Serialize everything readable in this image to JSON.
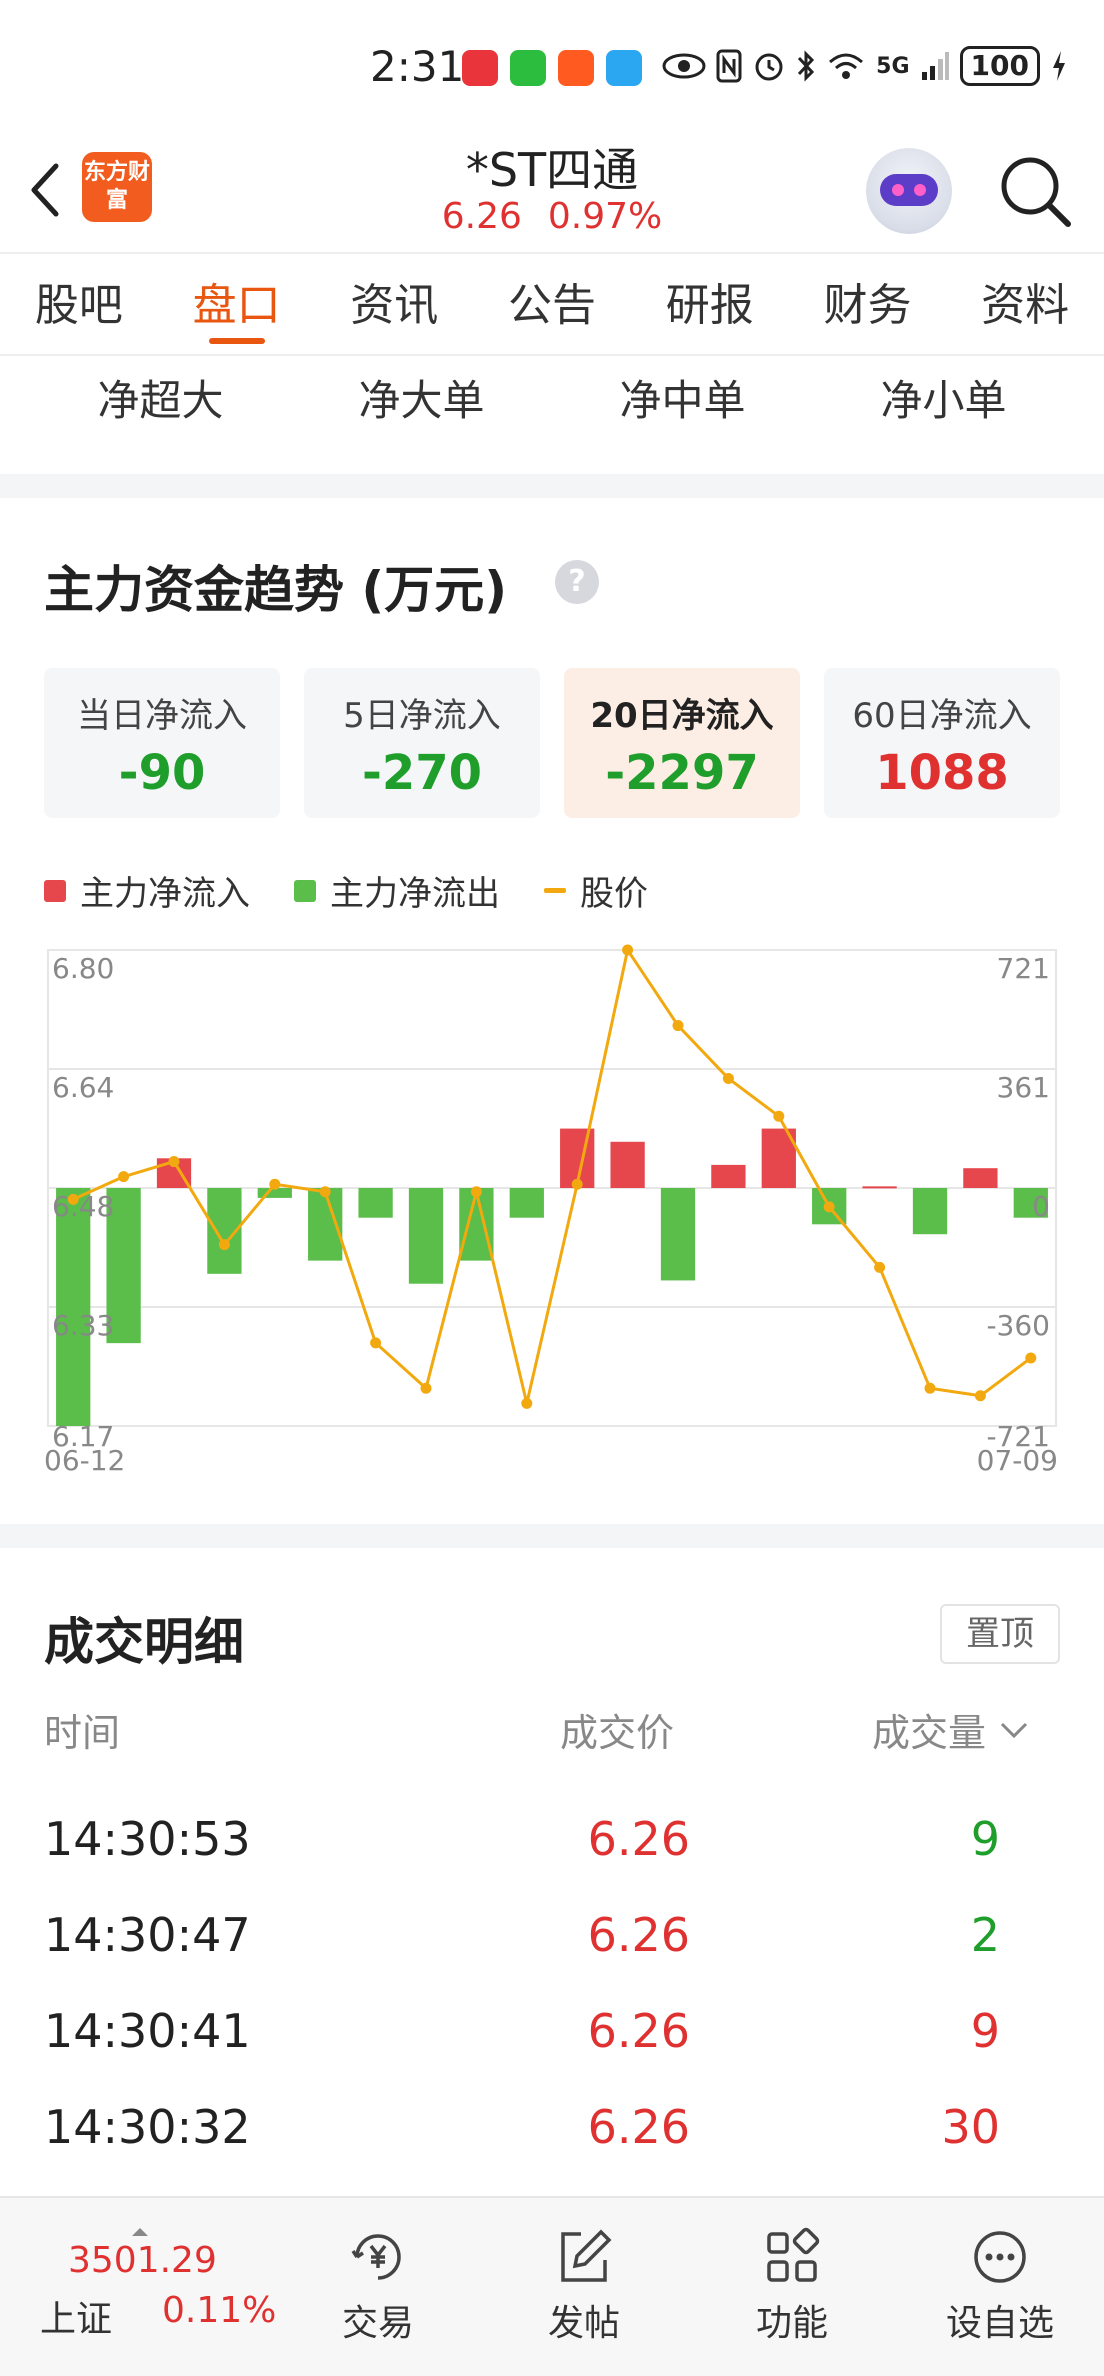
{
  "status_bar": {
    "time": "2:31",
    "network": "5G",
    "battery": "100"
  },
  "header": {
    "logo_text": "东方财富",
    "stock_name": "*ST四通",
    "price": "6.26",
    "change_pct": "0.97%"
  },
  "tabs": [
    {
      "label": "股吧"
    },
    {
      "label": "盘口"
    },
    {
      "label": "资讯"
    },
    {
      "label": "公告"
    },
    {
      "label": "研报"
    },
    {
      "label": "财务"
    },
    {
      "label": "资料"
    }
  ],
  "active_tab": "盘口",
  "subtabs": [
    {
      "label": "净超大"
    },
    {
      "label": "净大单"
    },
    {
      "label": "净中单"
    },
    {
      "label": "净小单"
    }
  ],
  "fund_section": {
    "title": "主力资金趋势 (万元)",
    "help_symbol": "?"
  },
  "flow_cards": [
    {
      "label": "当日净流入",
      "value": "-90",
      "color": "#1f9e2c",
      "active": false
    },
    {
      "label": "5日净流入",
      "value": "-270",
      "color": "#1f9e2c",
      "active": false
    },
    {
      "label": "20日净流入",
      "value": "-2297",
      "color": "#1f9e2c",
      "active": true
    },
    {
      "label": "60日净流入",
      "value": "1088",
      "color": "#e03131",
      "active": false
    }
  ],
  "legend": {
    "inflow": "主力净流入",
    "outflow": "主力净流出",
    "price": "股价"
  },
  "colors": {
    "accent": "#e8560f",
    "up": "#e03131",
    "down": "#1f9e2c",
    "bar_up": "#e5474d",
    "bar_down": "#5bbd4a",
    "price_line": "#f2a90f"
  },
  "chart_data": {
    "type": "bar",
    "title": "主力资金趋势 (万元)",
    "x_start_label": "06-12",
    "x_end_label": "07-09",
    "left_axis": {
      "ticks": [
        "6.80",
        "6.64",
        "6.48",
        "6.33",
        "6.17"
      ],
      "range": [
        6.17,
        6.8
      ]
    },
    "right_axis": {
      "ticks": [
        "721",
        "361",
        "0",
        "-360",
        "-721"
      ],
      "range": [
        -721,
        721
      ]
    },
    "grid": true,
    "series": [
      {
        "name": "主力净流入/主力净流出",
        "type": "bar",
        "values": [
          -721,
          -470,
          90,
          -260,
          -30,
          -220,
          -90,
          -290,
          -220,
          -90,
          180,
          140,
          -280,
          70,
          180,
          -110,
          5,
          -140,
          60,
          -90
        ]
      },
      {
        "name": "股价",
        "type": "line",
        "values": [
          6.47,
          6.5,
          6.52,
          6.41,
          6.49,
          6.48,
          6.28,
          6.22,
          6.48,
          6.2,
          6.49,
          6.8,
          6.7,
          6.63,
          6.58,
          6.46,
          6.38,
          6.22,
          6.21,
          6.26
        ]
      }
    ]
  },
  "detail": {
    "title": "成交明细",
    "pin_label": "置顶",
    "col_time": "时间",
    "col_price": "成交价",
    "col_volume": "成交量",
    "rows": [
      {
        "time": "14:30:53",
        "price": "6.26",
        "volume": "9",
        "vol_color": "#1f9e2c"
      },
      {
        "time": "14:30:47",
        "price": "6.26",
        "volume": "2",
        "vol_color": "#1f9e2c"
      },
      {
        "time": "14:30:41",
        "price": "6.26",
        "volume": "9",
        "vol_color": "#e03131"
      },
      {
        "time": "14:30:32",
        "price": "6.26",
        "volume": "30",
        "vol_color": "#e03131"
      }
    ]
  },
  "bottom_nav": {
    "index_value": "3501.29",
    "index_name": "上证",
    "index_change": "0.11%",
    "items": [
      {
        "label": "交易",
        "icon": "yuan-icon"
      },
      {
        "label": "发帖",
        "icon": "edit-icon"
      },
      {
        "label": "功能",
        "icon": "grid-icon"
      },
      {
        "label": "设自选",
        "icon": "more-icon"
      }
    ]
  }
}
